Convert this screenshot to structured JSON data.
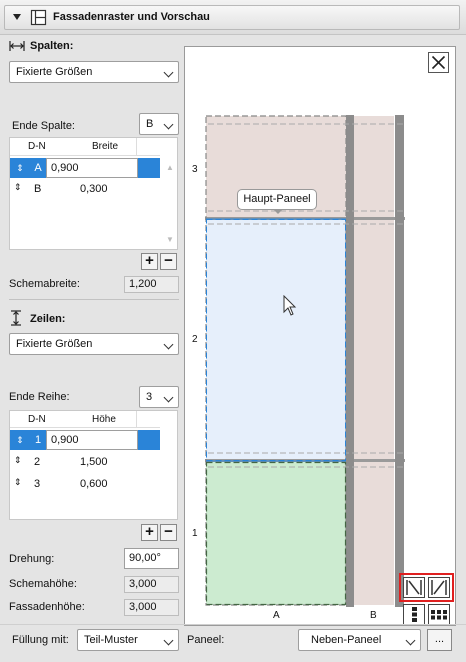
{
  "header": {
    "title": "Fassadenraster und Vorschau"
  },
  "columns": {
    "section_label": "Spalten:",
    "mode": "Fixierte Größen",
    "end_label": "Ende Spalte:",
    "end_value": "B",
    "table": {
      "col_id_header": "D-N",
      "col_value_header": "Breite",
      "rows": [
        {
          "id": "A",
          "value": "0,900"
        },
        {
          "id": "B",
          "value": "0,300"
        }
      ]
    },
    "scheme_label": "Schemabreite:",
    "scheme_value": "1,200"
  },
  "rows_section": {
    "section_label": "Zeilen:",
    "mode": "Fixierte Größen",
    "end_label": "Ende Reihe:",
    "end_value": "3",
    "table": {
      "col_id_header": "D-N",
      "col_value_header": "Höhe",
      "rows": [
        {
          "id": "1",
          "value": "0,900"
        },
        {
          "id": "2",
          "value": "1,500"
        },
        {
          "id": "3",
          "value": "0,600"
        }
      ]
    }
  },
  "rotation": {
    "label": "Drehung:",
    "value": "90,00°"
  },
  "scheme_height": {
    "label": "Schemahöhe:",
    "value": "3,000"
  },
  "facade_height": {
    "label": "Fassadenhöhe:",
    "value": "3,000"
  },
  "fill": {
    "label": "Füllung mit:",
    "value": "Teil-Muster"
  },
  "panel": {
    "label": "Paneel:",
    "value": "Neben-Paneel",
    "more_label": "..."
  },
  "preview": {
    "tooltip": "Haupt-Paneel",
    "row_labels": [
      "3",
      "2",
      "1"
    ],
    "col_labels": [
      "A",
      "B"
    ],
    "colors": {
      "top_panel": "#e8dcd9",
      "middle_panel": "#e6effb",
      "bottom_panel": "#ccebd0",
      "mullion": "#8c8c8c",
      "highlight_box": "#e02020"
    }
  }
}
